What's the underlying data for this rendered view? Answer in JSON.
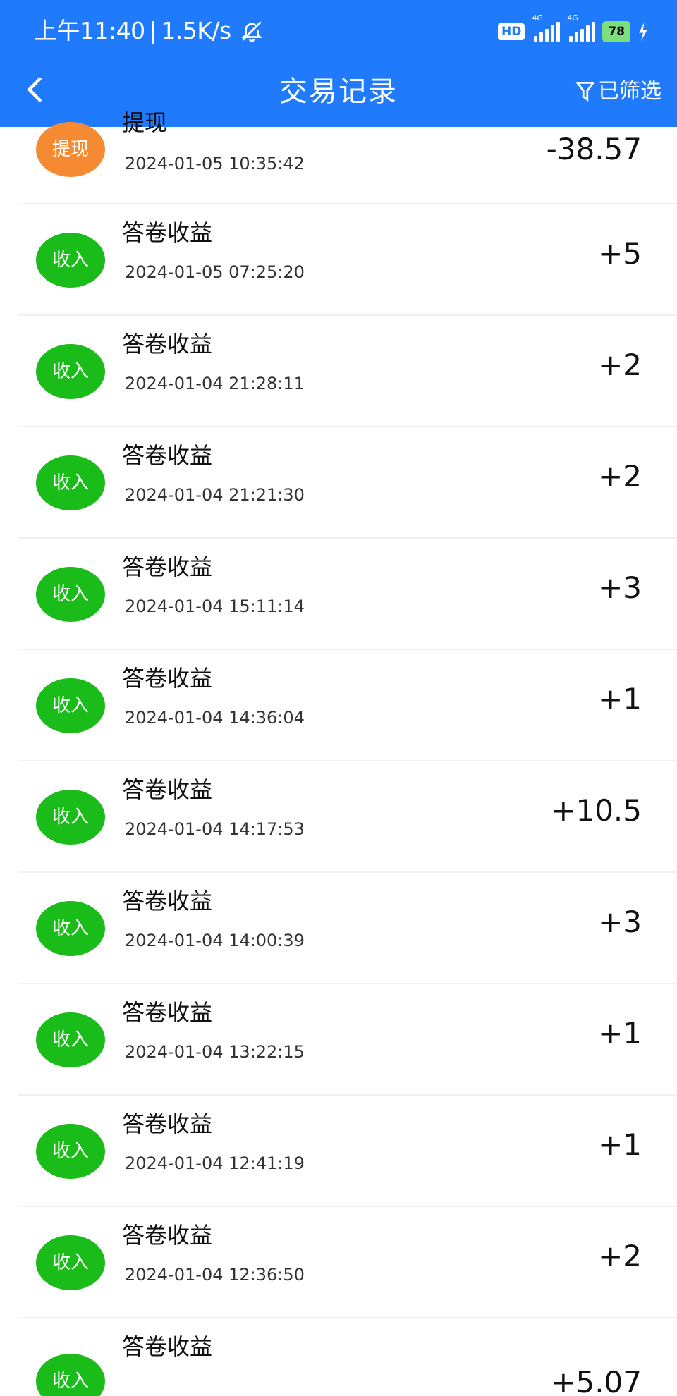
{
  "status_bar": {
    "time": "上午11:40",
    "separator": "|",
    "net_speed": "1.5K/s",
    "hd_label": "HD",
    "network_1": "4G",
    "network_2": "4G",
    "battery": "78"
  },
  "header": {
    "title": "交易记录",
    "filter_label": "已筛选"
  },
  "transactions": [
    {
      "badge": "提现",
      "type": "withdraw",
      "title": "提现",
      "time": "2024-01-05 10:35:42",
      "amount": "-38.57"
    },
    {
      "badge": "收入",
      "type": "income",
      "title": "答卷收益",
      "time": "2024-01-05 07:25:20",
      "amount": "+5"
    },
    {
      "badge": "收入",
      "type": "income",
      "title": "答卷收益",
      "time": "2024-01-04 21:28:11",
      "amount": "+2"
    },
    {
      "badge": "收入",
      "type": "income",
      "title": "答卷收益",
      "time": "2024-01-04 21:21:30",
      "amount": "+2"
    },
    {
      "badge": "收入",
      "type": "income",
      "title": "答卷收益",
      "time": "2024-01-04 15:11:14",
      "amount": "+3"
    },
    {
      "badge": "收入",
      "type": "income",
      "title": "答卷收益",
      "time": "2024-01-04 14:36:04",
      "amount": "+1"
    },
    {
      "badge": "收入",
      "type": "income",
      "title": "答卷收益",
      "time": "2024-01-04 14:17:53",
      "amount": "+10.5"
    },
    {
      "badge": "收入",
      "type": "income",
      "title": "答卷收益",
      "time": "2024-01-04 14:00:39",
      "amount": "+3"
    },
    {
      "badge": "收入",
      "type": "income",
      "title": "答卷收益",
      "time": "2024-01-04 13:22:15",
      "amount": "+1"
    },
    {
      "badge": "收入",
      "type": "income",
      "title": "答卷收益",
      "time": "2024-01-04 12:41:19",
      "amount": "+1"
    },
    {
      "badge": "收入",
      "type": "income",
      "title": "答卷收益",
      "time": "2024-01-04 12:36:50",
      "amount": "+2"
    },
    {
      "badge": "收入",
      "type": "income",
      "title": "答卷收益",
      "time": "",
      "amount": "+5.07"
    }
  ],
  "colors": {
    "header_blue": "#1F7BFB",
    "income_green": "#19BC19",
    "withdraw_orange": "#F58A33"
  }
}
